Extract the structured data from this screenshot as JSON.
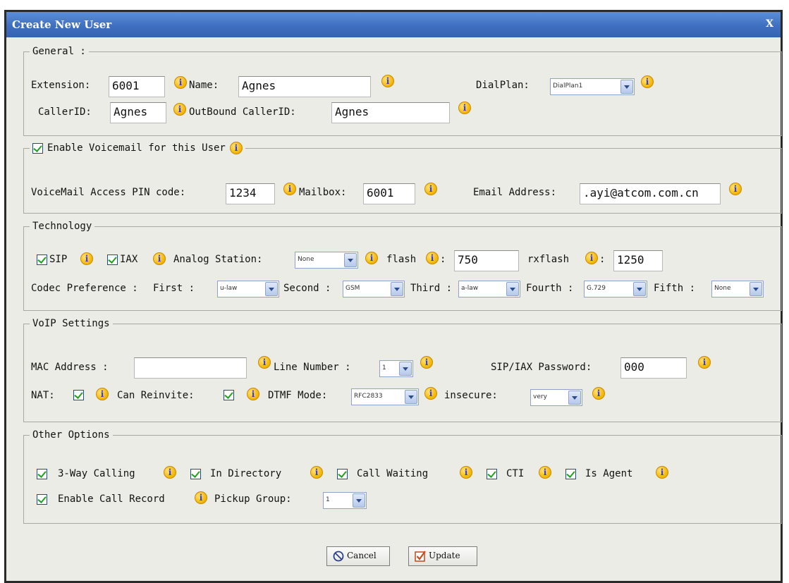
{
  "window": {
    "title": "Create New User",
    "close": "X"
  },
  "general": {
    "legend": "General :",
    "extension_label": "Extension:",
    "extension_value": "6001",
    "name_label": "Name:",
    "name_value": "Agnes",
    "dialplan_label": "DialPlan:",
    "dialplan_value": "DialPlan1",
    "callerid_label": "CallerID:",
    "callerid_value": "Agnes",
    "outbound_label": "OutBound CallerID:",
    "outbound_value": "Agnes"
  },
  "voicemail": {
    "legend": "Enable Voicemail for this User",
    "pin_label": "VoiceMail Access PIN code:",
    "pin_value": "1234",
    "mailbox_label": "Mailbox:",
    "mailbox_value": "6001",
    "email_label": "Email Address:",
    "email_value": ".ayi@atcom.com.cn"
  },
  "technology": {
    "legend": "Technology",
    "sip_label": "SIP",
    "iax_label": "IAX",
    "analog_label": "Analog Station:",
    "analog_value": "None",
    "flash_label": "flash",
    "flash_value": "750",
    "rxflash_label": "rxflash",
    "rxflash_value": "1250",
    "colon": ":",
    "codec_label": "Codec Preference :",
    "first_label": "First :",
    "first_value": "u-law",
    "second_label": "Second :",
    "second_value": "GSM",
    "third_label": "Third :",
    "third_value": "a-law",
    "fourth_label": "Fourth :",
    "fourth_value": "G.729",
    "fifth_label": "Fifth :",
    "fifth_value": "None"
  },
  "voip": {
    "legend": "VoIP Settings",
    "mac_label": "MAC Address :",
    "mac_value": "",
    "line_label": "Line Number :",
    "line_value": "1",
    "password_label": "SIP/IAX Password:",
    "password_value": "000",
    "nat_label": "NAT:",
    "reinvite_label": "Can Reinvite:",
    "dtmf_label": "DTMF Mode:",
    "dtmf_value": "RFC2833",
    "insecure_label": "insecure:",
    "insecure_value": "very"
  },
  "other": {
    "legend": "Other Options",
    "threeway_label": "3-Way Calling",
    "directory_label": "In Directory",
    "callwaiting_label": "Call Waiting",
    "cti_label": "CTI",
    "agent_label": "Is Agent",
    "record_label": "Enable Call Record",
    "pickup_label": "Pickup Group:",
    "pickup_value": "1"
  },
  "buttons": {
    "cancel": "Cancel",
    "update": "Update"
  },
  "colors": {
    "titlebar": "#3f6fc0",
    "dialog_bg": "#ecece6",
    "check": "#21a121"
  }
}
